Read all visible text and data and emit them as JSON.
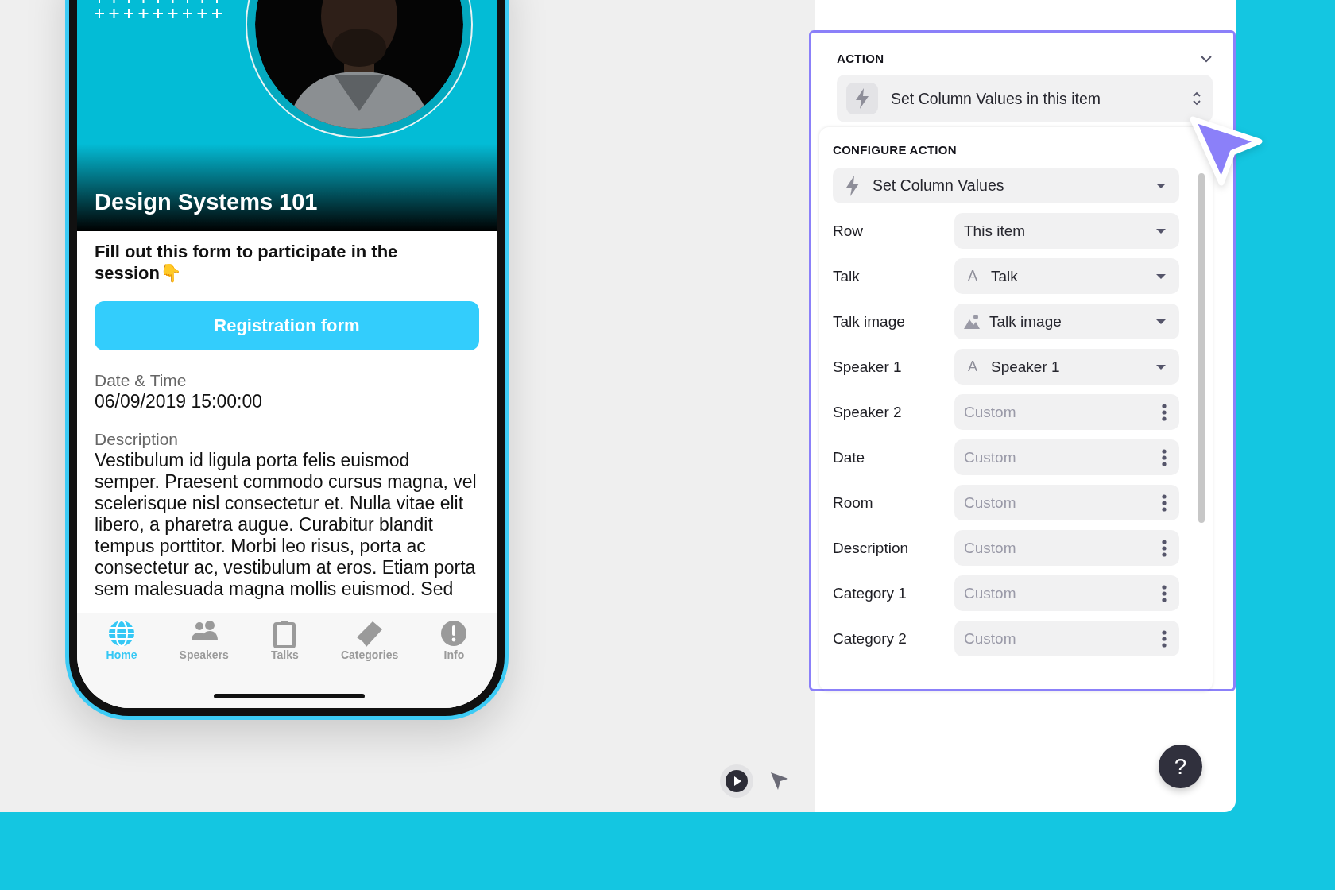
{
  "phone": {
    "title": "Design Systems 101",
    "prompt": "Fill out this form to participate in the session👇",
    "button": "Registration form",
    "details": [
      {
        "label": "Date & Time",
        "value": "06/09/2019 15:00:00"
      },
      {
        "label": "Description",
        "value": "Vestibulum id ligula porta felis euismod semper. Praesent commodo cursus magna, vel scelerisque nisl consectetur et. Nulla vitae elit libero, a pharetra augue. Curabitur blandit tempus porttitor. Morbi leo risus, porta ac consectetur ac, vestibulum at eros. Etiam porta sem malesuada magna mollis euismod. Sed"
      }
    ],
    "tabs": [
      {
        "label": "Home",
        "selected": true
      },
      {
        "label": "Speakers",
        "selected": false
      },
      {
        "label": "Talks",
        "selected": false
      },
      {
        "label": "Categories",
        "selected": false
      },
      {
        "label": "Info",
        "selected": false
      }
    ]
  },
  "action_panel": {
    "title": "ACTION",
    "expanded": true,
    "action": "Set Column Values in this item",
    "configure": {
      "title": "CONFIGURE ACTION",
      "action": "Set Column Values",
      "fields": [
        {
          "label": "Row",
          "kind": "select",
          "value": "This item"
        },
        {
          "label": "Talk",
          "kind": "select",
          "type_glyph": "A",
          "value": "Talk"
        },
        {
          "label": "Talk image",
          "kind": "select",
          "image_type": true,
          "value": "Talk image"
        },
        {
          "label": "Speaker 1",
          "kind": "select",
          "type_glyph": "A",
          "value": "Speaker 1"
        },
        {
          "label": "Speaker 2",
          "kind": "custom",
          "placeholder": "Custom"
        },
        {
          "label": "Date",
          "kind": "custom",
          "placeholder": "Custom"
        },
        {
          "label": "Room",
          "kind": "custom",
          "placeholder": "Custom"
        },
        {
          "label": "Description",
          "kind": "custom",
          "placeholder": "Custom"
        },
        {
          "label": "Category 1",
          "kind": "custom",
          "placeholder": "Custom"
        },
        {
          "label": "Category 2",
          "kind": "custom",
          "placeholder": "Custom"
        }
      ]
    }
  },
  "help_button": "?"
}
